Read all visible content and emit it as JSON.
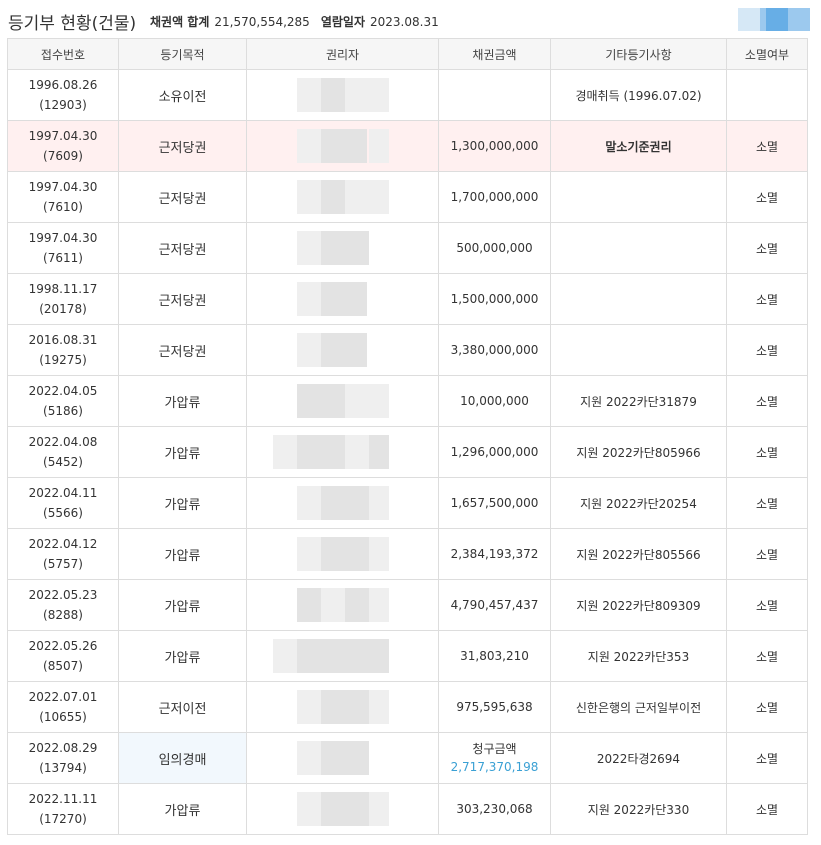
{
  "header": {
    "title": "등기부 현황(건물)",
    "total_label": "채권액 합계",
    "total_value": "21,570,554,285",
    "date_label": "열람일자",
    "date_value": "2023.08.31"
  },
  "legend_colors": [
    "#d6e8f6",
    "#9cc9ee",
    "#67aee6",
    "#9cc9ee"
  ],
  "columns": [
    "접수번호",
    "등기목적",
    "권리자",
    "채권금액",
    "기타등기사항",
    "소멸여부"
  ],
  "rows": [
    {
      "date": "1996.08.26",
      "num": "(12903)",
      "purpose": "소유이전",
      "amount": "",
      "etc": "경매취득 (1996.07.02)",
      "extinct": ""
    },
    {
      "date": "1997.04.30",
      "num": "(7609)",
      "purpose": "근저당권",
      "amount": "1,300,000,000",
      "etc": "말소기준권리",
      "extinct": "소멸"
    },
    {
      "date": "1997.04.30",
      "num": "(7610)",
      "purpose": "근저당권",
      "amount": "1,700,000,000",
      "etc": "",
      "extinct": "소멸"
    },
    {
      "date": "1997.04.30",
      "num": "(7611)",
      "purpose": "근저당권",
      "amount": "500,000,000",
      "etc": "",
      "extinct": "소멸"
    },
    {
      "date": "1998.11.17",
      "num": "(20178)",
      "purpose": "근저당권",
      "amount": "1,500,000,000",
      "etc": "",
      "extinct": "소멸"
    },
    {
      "date": "2016.08.31",
      "num": "(19275)",
      "purpose": "근저당권",
      "amount": "3,380,000,000",
      "etc": "",
      "extinct": "소멸"
    },
    {
      "date": "2022.04.05",
      "num": "(5186)",
      "purpose": "가압류",
      "amount": "10,000,000",
      "etc": "지원 2022카단31879",
      "extinct": "소멸"
    },
    {
      "date": "2022.04.08",
      "num": "(5452)",
      "purpose": "가압류",
      "amount": "1,296,000,000",
      "etc": "지원 2022카단805966",
      "extinct": "소멸"
    },
    {
      "date": "2022.04.11",
      "num": "(5566)",
      "purpose": "가압류",
      "amount": "1,657,500,000",
      "etc": "지원 2022카단20254",
      "extinct": "소멸"
    },
    {
      "date": "2022.04.12",
      "num": "(5757)",
      "purpose": "가압류",
      "amount": "2,384,193,372",
      "etc": "지원 2022카단805566",
      "extinct": "소멸"
    },
    {
      "date": "2022.05.23",
      "num": "(8288)",
      "purpose": "가압류",
      "amount": "4,790,457,437",
      "etc": "지원 2022카단809309",
      "extinct": "소멸"
    },
    {
      "date": "2022.05.26",
      "num": "(8507)",
      "purpose": "가압류",
      "amount": "31,803,210",
      "etc": "지원 2022카단353",
      "extinct": "소멸"
    },
    {
      "date": "2022.07.01",
      "num": "(10655)",
      "purpose": "근저이전",
      "amount": "975,595,638",
      "etc": "신한은행의 근저일부이전",
      "extinct": "소멸"
    },
    {
      "date": "2022.08.29",
      "num": "(13794)",
      "purpose": "임의경매",
      "amount": "",
      "claim_label": "청구금액",
      "claim_value": "2,717,370,198",
      "etc": "2022타경2694",
      "extinct": "소멸"
    },
    {
      "date": "2022.11.11",
      "num": "(17270)",
      "purpose": "가압류",
      "amount": "303,230,068",
      "etc": "지원 2022카단330",
      "extinct": "소멸"
    }
  ],
  "styles": {
    "base_row_bg": "#fff0f0",
    "auction_cell_bg": "#f2f8fd",
    "claim_color": "#3aa0d4"
  }
}
